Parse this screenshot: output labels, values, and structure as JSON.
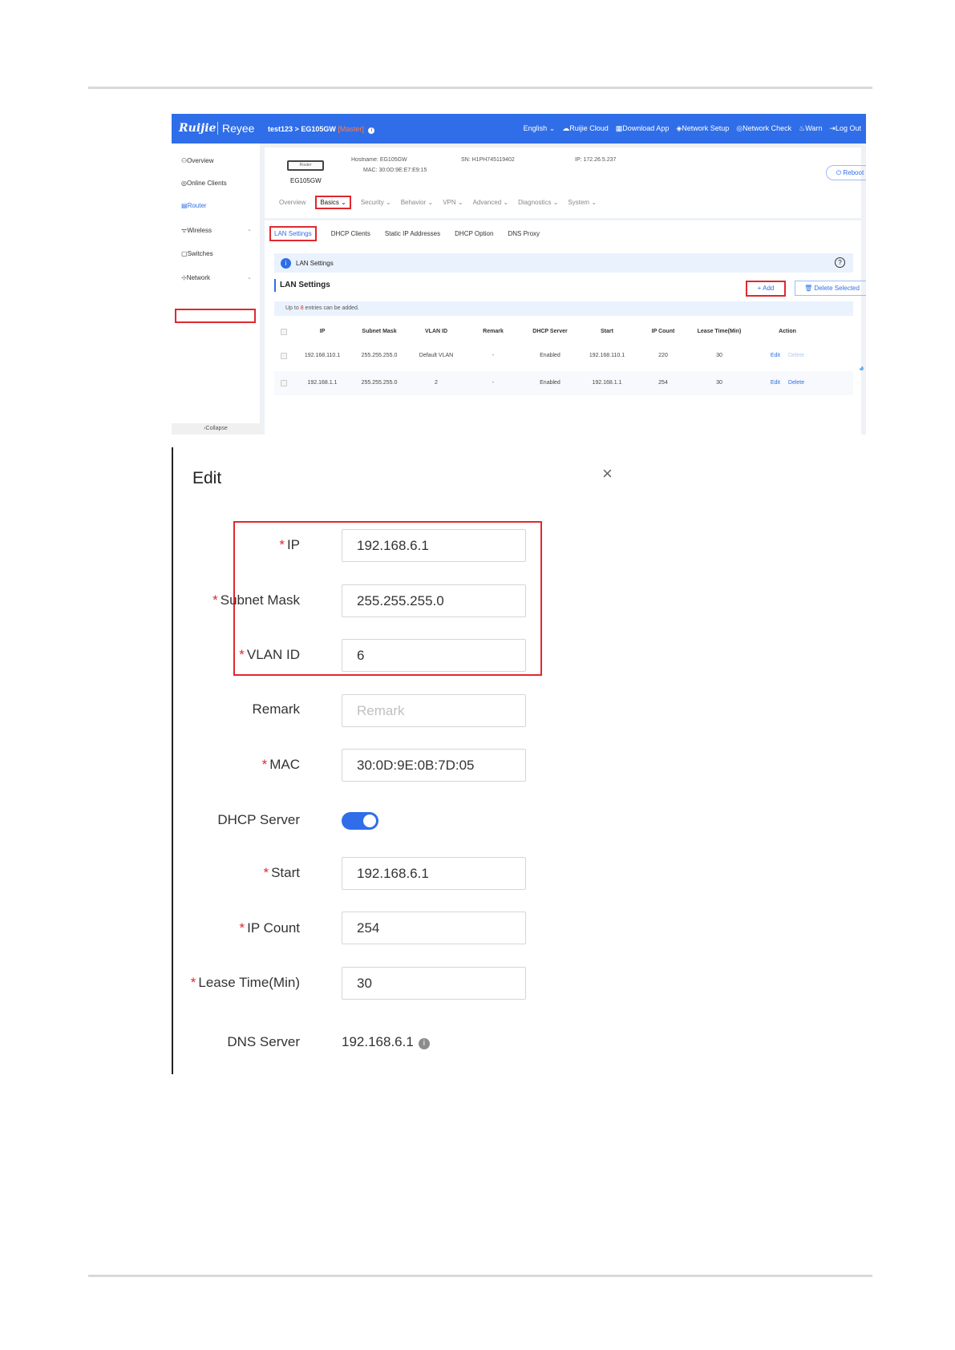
{
  "topbar": {
    "logo": "Ruijie",
    "logo2": "Reyee",
    "breadcrumb_project": "test123",
    "breadcrumb_arrow": ">",
    "breadcrumb_device": "EG105GW",
    "breadcrumb_role": "[Master]",
    "nav": [
      "English",
      "Ruijie Cloud",
      "Download App",
      "Network Setup",
      "Network Check",
      "Warn",
      "Log Out"
    ]
  },
  "sidebar": {
    "items": [
      "Overview",
      "Online Clients",
      "Router",
      "Wireless",
      "Switches",
      "Network"
    ],
    "collapse": "Collapse"
  },
  "device": {
    "image_label": "Router",
    "name": "EG105GW",
    "hostname_label": "Hostname:",
    "hostname": "EG105GW",
    "mac_label": "MAC:",
    "mac": "30:0D:9E:E7:E9:15",
    "sn_label": "SN:",
    "sn": "H1PH745119402",
    "ip_label": "IP:",
    "ip": "172.26.5.237",
    "reboot": "Reboot"
  },
  "tabs1": [
    "Overview",
    "Basics",
    "Security",
    "Behavior",
    "VPN",
    "Advanced",
    "Diagnostics",
    "System"
  ],
  "tabs2": [
    "LAN Settings",
    "DHCP Clients",
    "Static IP Addresses",
    "DHCP Option",
    "DNS Proxy"
  ],
  "lan": {
    "info_title": "LAN Settings",
    "section_title": "LAN Settings",
    "add": "+ Add",
    "delete_selected": "Delete Selected",
    "note_prefix": "Up to",
    "note_count": "8",
    "note_suffix": "entries can be added.",
    "columns": [
      "IP",
      "Subnet Mask",
      "VLAN ID",
      "Remark",
      "DHCP Server",
      "Start",
      "IP Count",
      "Lease Time(Min)",
      "Action"
    ],
    "rows": [
      [
        "192.168.110.1",
        "255.255.255.0",
        "Default VLAN",
        "-",
        "Enabled",
        "192.168.110.1",
        "220",
        "30"
      ],
      [
        "192.168.1.1",
        "255.255.255.0",
        "2",
        "-",
        "Enabled",
        "192.168.1.1",
        "254",
        "30"
      ]
    ],
    "edit": "Edit",
    "delete": "Delete"
  },
  "edit_form": {
    "title": "Edit",
    "close": "×",
    "fields": {
      "ip": {
        "label": "IP",
        "value": "192.168.6.1"
      },
      "subnet_mask": {
        "label": "Subnet Mask",
        "value": "255.255.255.0"
      },
      "vlan_id": {
        "label": "VLAN ID",
        "value": "6"
      },
      "remark": {
        "label": "Remark",
        "placeholder": "Remark"
      },
      "mac": {
        "label": "MAC",
        "value": "30:0D:9E:0B:7D:05"
      },
      "dhcp_server": {
        "label": "DHCP Server",
        "enabled": true
      },
      "start": {
        "label": "Start",
        "value": "192.168.6.1"
      },
      "ip_count": {
        "label": "IP Count",
        "value": "254"
      },
      "lease_time": {
        "label": "Lease Time(Min)",
        "value": "30"
      },
      "dns_server": {
        "label": "DNS Server",
        "value": "192.168.6.1"
      }
    },
    "required_mark": "*"
  },
  "colors": {
    "primary": "#2f6ee8",
    "highlight": "#e0282f",
    "warning": "#ff7a45"
  },
  "icons": [
    "overview-icon",
    "clients-icon",
    "router-icon",
    "wifi-icon",
    "switch-icon",
    "network-icon",
    "info-icon",
    "help-icon",
    "reboot-icon",
    "close-icon"
  ]
}
